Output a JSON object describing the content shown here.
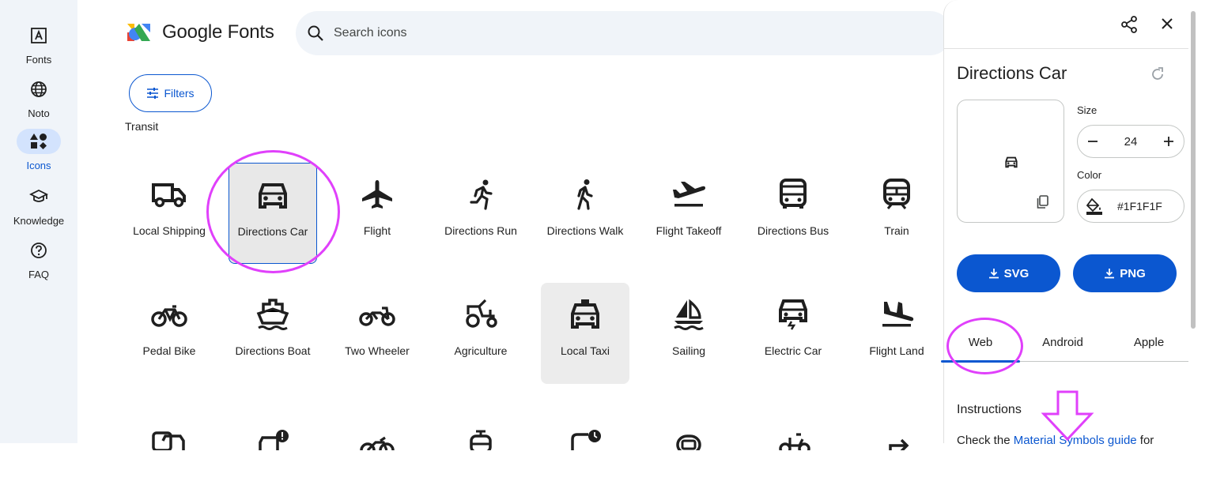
{
  "nav": {
    "items": [
      {
        "label": "Fonts",
        "icon": "font-icon",
        "active": false
      },
      {
        "label": "Noto",
        "icon": "globe-icon",
        "active": false
      },
      {
        "label": "Icons",
        "icon": "shapes-icon",
        "active": true
      },
      {
        "label": "Knowledge",
        "icon": "school-icon",
        "active": false
      },
      {
        "label": "FAQ",
        "icon": "help-icon",
        "active": false
      }
    ]
  },
  "header": {
    "logo_text": "Google Fonts",
    "search_placeholder": "Search icons"
  },
  "filters_label": "Filters",
  "category": "Transit",
  "icons": [
    {
      "label": "Local Shipping",
      "icon": "local-shipping-icon"
    },
    {
      "label": "Directions Car",
      "icon": "directions-car-icon",
      "selected": true
    },
    {
      "label": "Flight",
      "icon": "flight-icon"
    },
    {
      "label": "Directions Run",
      "icon": "directions-run-icon"
    },
    {
      "label": "Directions Walk",
      "icon": "directions-walk-icon"
    },
    {
      "label": "Flight Takeoff",
      "icon": "flight-takeoff-icon"
    },
    {
      "label": "Directions Bus",
      "icon": "directions-bus-icon"
    },
    {
      "label": "Train",
      "icon": "train-icon"
    },
    {
      "label": "Pedal Bike",
      "icon": "pedal-bike-icon"
    },
    {
      "label": "Directions Boat",
      "icon": "directions-boat-icon"
    },
    {
      "label": "Two Wheeler",
      "icon": "two-wheeler-icon"
    },
    {
      "label": "Agriculture",
      "icon": "agriculture-icon"
    },
    {
      "label": "Local Taxi",
      "icon": "local-taxi-icon",
      "hovered": true
    },
    {
      "label": "Sailing",
      "icon": "sailing-icon"
    },
    {
      "label": "Electric Car",
      "icon": "electric-car-icon"
    },
    {
      "label": "Flight Land",
      "icon": "flight-land-icon"
    }
  ],
  "panel": {
    "title": "Directions Car",
    "size_label": "Size",
    "size_value": "24",
    "color_label": "Color",
    "color_value": "#1F1F1F",
    "svg_button": "SVG",
    "png_button": "PNG",
    "tabs": [
      "Web",
      "Android",
      "Apple"
    ],
    "active_tab": "Web",
    "instructions_heading": "Instructions",
    "instructions_prefix": "Check the ",
    "instructions_link": "Material Symbols guide",
    "instructions_suffix": " for"
  },
  "colors": {
    "accent": "#0b57d0",
    "annotation": "#e040fb",
    "icon": "#1f1f1f"
  }
}
